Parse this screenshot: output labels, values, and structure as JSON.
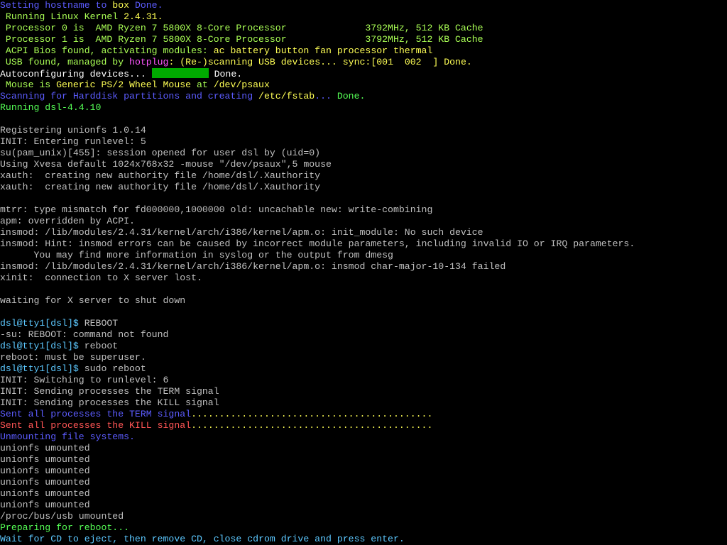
{
  "terminal": {
    "background": "#000000",
    "default_color": "#c0c0c0",
    "colors": {
      "blue": "#5c5cff",
      "yellow": "#ffff55",
      "green": "#55ff55",
      "light_green": "#aaff55",
      "magenta": "#ff55ff",
      "red": "#ff5555",
      "white": "#c0c0c0",
      "progress_fill": "#00aa00"
    },
    "lines": [
      [
        {
          "t": "Setting hostname to ",
          "c": "#5c5cff"
        },
        {
          "t": "box",
          "c": "#ffff55"
        },
        {
          "t": " Done.",
          "c": "#5c5cff"
        }
      ],
      [
        {
          "t": " Running Linux Kernel ",
          "c": "#aaff55"
        },
        {
          "t": "2.4.31.",
          "c": "#ffff55"
        }
      ],
      [
        {
          "t": " Processor 0 is  AMD Ryzen 7 5800X 8-Core Processor              3792MHz, 512 KB Cache",
          "c": "#aaff55"
        }
      ],
      [
        {
          "t": " Processor 1 is  AMD Ryzen 7 5800X 8-Core Processor              3792MHz, 512 KB Cache",
          "c": "#aaff55"
        }
      ],
      [
        {
          "t": " ACPI Bios found, activating modules: ",
          "c": "#aaff55"
        },
        {
          "t": "ac battery button fan processor thermal",
          "c": "#ffff55"
        }
      ],
      [
        {
          "t": " USB found, managed by ",
          "c": "#aaff55"
        },
        {
          "t": "hotplug",
          "c": "#ff55ff"
        },
        {
          "t": ": (Re-)scanning USB devices... sync:[001  002  ] Done.",
          "c": "#ffff55"
        }
      ],
      [
        {
          "t": "Autoconfiguring devices... ",
          "c": "#ffffff"
        },
        {
          "block": true,
          "w": 80,
          "c": "#00aa00"
        },
        {
          "t": " Done.",
          "c": "#ffffff"
        }
      ],
      [
        {
          "t": " Mouse is ",
          "c": "#aaff55"
        },
        {
          "t": "Generic PS/2 Wheel Mouse",
          "c": "#ffff55"
        },
        {
          "t": " at ",
          "c": "#aaff55"
        },
        {
          "t": "/dev/psaux",
          "c": "#ffff55"
        }
      ],
      [
        {
          "t": "Scanning for Harddisk partitions and creating ",
          "c": "#5c5cff"
        },
        {
          "t": "/etc/fstab",
          "c": "#ffff55"
        },
        {
          "t": "... ",
          "c": "#5c5cff"
        },
        {
          "t": "Done.",
          "c": "#55ff55"
        }
      ],
      [
        {
          "t": "Running dsl-4.4.10",
          "c": "#55ff55"
        }
      ],
      [],
      [
        {
          "t": "Registering unionfs 1.0.14",
          "c": "#c0c0c0"
        }
      ],
      [
        {
          "t": "INIT: Entering runlevel: 5",
          "c": "#c0c0c0"
        }
      ],
      [
        {
          "t": "su(pam_unix)[455]: session opened for user dsl by (uid=0)",
          "c": "#c0c0c0"
        }
      ],
      [
        {
          "t": "Using Xvesa default 1024x768x32 -mouse \"/dev/psaux\",5 mouse",
          "c": "#c0c0c0"
        }
      ],
      [
        {
          "t": "xauth:  creating new authority file /home/dsl/.Xauthority",
          "c": "#c0c0c0"
        }
      ],
      [
        {
          "t": "xauth:  creating new authority file /home/dsl/.Xauthority",
          "c": "#c0c0c0"
        }
      ],
      [],
      [
        {
          "t": "mtrr: type mismatch for fd000000,1000000 old: uncachable new: write-combining",
          "c": "#c0c0c0"
        }
      ],
      [
        {
          "t": "apm: overridden by ACPI.",
          "c": "#c0c0c0"
        }
      ],
      [
        {
          "t": "insmod: /lib/modules/2.4.31/kernel/arch/i386/kernel/apm.o: init_module: No such device",
          "c": "#c0c0c0"
        }
      ],
      [
        {
          "t": "insmod: Hint: insmod errors can be caused by incorrect module parameters, including invalid IO or IRQ parameters.",
          "c": "#c0c0c0"
        }
      ],
      [
        {
          "t": "      You may find more information in syslog or the output from dmesg",
          "c": "#c0c0c0"
        }
      ],
      [
        {
          "t": "insmod: /lib/modules/2.4.31/kernel/arch/i386/kernel/apm.o: insmod char-major-10-134 failed",
          "c": "#c0c0c0"
        }
      ],
      [
        {
          "t": "xinit:  connection to X server lost.",
          "c": "#c0c0c0"
        }
      ],
      [],
      [
        {
          "t": "waiting for X server to shut down",
          "c": "#c0c0c0"
        }
      ],
      [],
      [
        {
          "t": "dsl@tty1[dsl]$",
          "c": "#5cc8ff"
        },
        {
          "t": " REBOOT",
          "c": "#c0c0c0"
        }
      ],
      [
        {
          "t": "-su: REBOOT: command not found",
          "c": "#c0c0c0"
        }
      ],
      [
        {
          "t": "dsl@tty1[dsl]$",
          "c": "#5cc8ff"
        },
        {
          "t": " reboot",
          "c": "#c0c0c0"
        }
      ],
      [
        {
          "t": "reboot: must be superuser.",
          "c": "#c0c0c0"
        }
      ],
      [
        {
          "t": "dsl@tty1[dsl]$",
          "c": "#5cc8ff"
        },
        {
          "t": " sudo reboot",
          "c": "#c0c0c0"
        }
      ],
      [
        {
          "t": "INIT: Switching to runlevel: 6",
          "c": "#c0c0c0"
        }
      ],
      [
        {
          "t": "INIT: Sending processes the TERM signal",
          "c": "#c0c0c0"
        }
      ],
      [
        {
          "t": "INIT: Sending processes the KILL signal",
          "c": "#c0c0c0"
        }
      ],
      [
        {
          "t": "Sent all processes the TERM signal",
          "c": "#5c5cff"
        },
        {
          "t": "...........................................",
          "c": "#ffff55"
        }
      ],
      [
        {
          "t": "Sent all processes the KILL signal",
          "c": "#ff5555"
        },
        {
          "t": "...........................................",
          "c": "#ffff55"
        }
      ],
      [
        {
          "t": "Unmounting file systems.",
          "c": "#5c5cff"
        }
      ],
      [
        {
          "t": "unionfs umounted",
          "c": "#c0c0c0"
        }
      ],
      [
        {
          "t": "unionfs umounted",
          "c": "#c0c0c0"
        }
      ],
      [
        {
          "t": "unionfs umounted",
          "c": "#c0c0c0"
        }
      ],
      [
        {
          "t": "unionfs umounted",
          "c": "#c0c0c0"
        }
      ],
      [
        {
          "t": "unionfs umounted",
          "c": "#c0c0c0"
        }
      ],
      [
        {
          "t": "unionfs umounted",
          "c": "#c0c0c0"
        }
      ],
      [
        {
          "t": "/proc/bus/usb umounted",
          "c": "#c0c0c0"
        }
      ],
      [
        {
          "t": "Preparing for reboot...",
          "c": "#55ff55"
        }
      ],
      [
        {
          "t": "Wait for CD to eject, then remove CD, close cdrom drive and press enter.",
          "c": "#5cc8ff"
        }
      ]
    ]
  }
}
